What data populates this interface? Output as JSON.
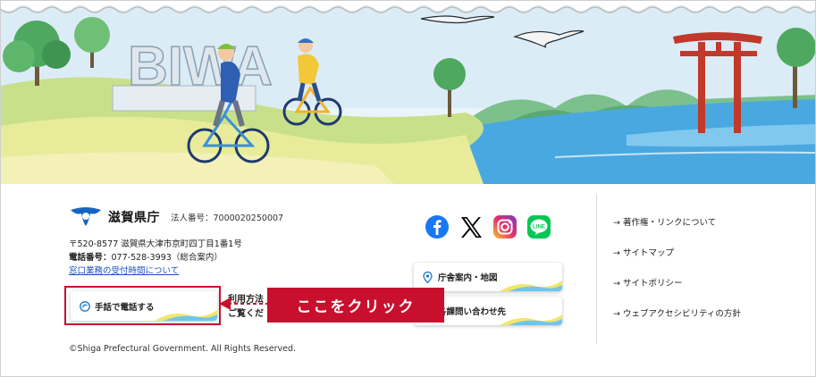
{
  "banner": {
    "sign_text": "BIWA"
  },
  "footer": {
    "org_name": "滋賀県庁",
    "corp_number": "法人番号：7000020250007",
    "postal_address": "〒520-8577 滋賀県大津市京町四丁目1番1号",
    "phone_label": "電話番号：",
    "phone_value": "077-528-3993（総合案内）",
    "office_hours_link": "窓口業務の受付時間について",
    "sign_language_button": "手話で電話する",
    "behind_text_line1": "利用方法",
    "behind_text_line2": "ご覧くだ",
    "callout_label": "ここをクリック",
    "copyright": "©Shiga Prefectural Government. All Rights Reserved.",
    "social": [
      {
        "name": "facebook-icon",
        "color": "#1877f2"
      },
      {
        "name": "x-icon",
        "color": "#000000"
      },
      {
        "name": "instagram-icon",
        "color": "#e1306c"
      },
      {
        "name": "line-icon",
        "color": "#06c755"
      }
    ],
    "pills": {
      "office_map": "庁舎案内・地図",
      "contact": "各課問い合わせ先"
    },
    "right_links": [
      "→ 著作権・リンクについて",
      "→ サイトマップ",
      "→ サイトポリシー",
      "→ ウェブアクセシビリティの方針"
    ]
  },
  "colors": {
    "accent_red": "#c8102e",
    "link_blue": "#1a4fbf",
    "lake_blue": "#4aa8e0"
  }
}
